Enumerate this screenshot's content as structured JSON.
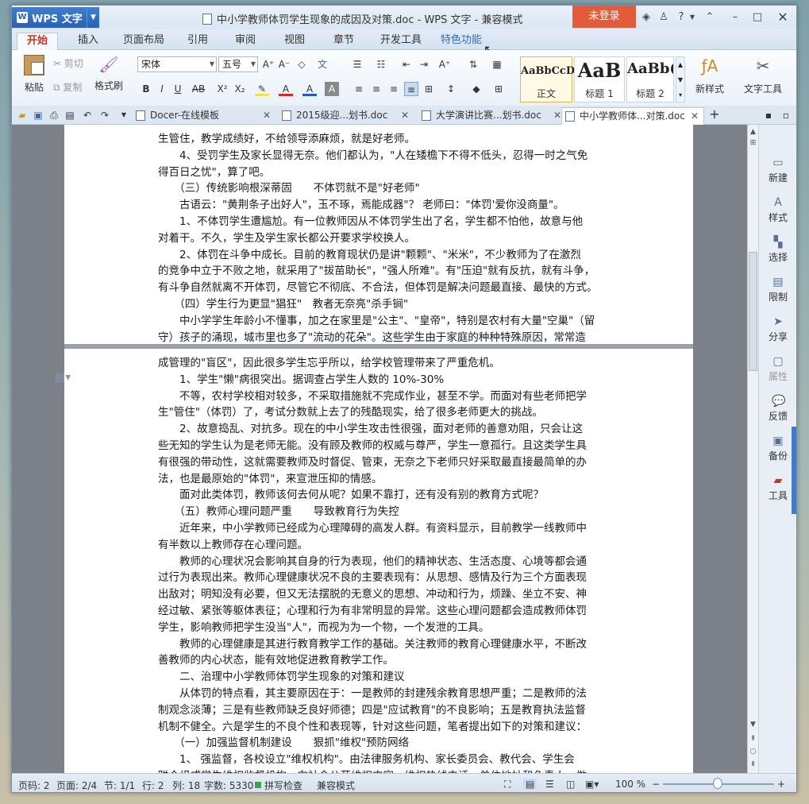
{
  "app": {
    "brand": "WPS 文字",
    "window_title": "中小学教师体罚学生现象的成因及对策.doc - WPS 文字 - 兼容模式",
    "login_label": "未登录",
    "help_label": "?"
  },
  "menu": {
    "tabs": [
      "开始",
      "插入",
      "页面布局",
      "引用",
      "审阅",
      "视图",
      "章节",
      "开发工具",
      "特色功能"
    ],
    "active": "开始"
  },
  "ribbon": {
    "paste": "粘贴",
    "cut": "剪切",
    "copy": "复制",
    "format_painter": "格式刷",
    "font_name": "宋体",
    "font_size": "五号",
    "styles": [
      {
        "sample": "AaBbCcD",
        "name": "正文"
      },
      {
        "sample": "AaB",
        "name": "标题 1"
      },
      {
        "sample": "AaBb(",
        "name": "标题 2"
      }
    ],
    "new_style": "新样式",
    "text_tools": "文字工具"
  },
  "doc_tabs": [
    {
      "label": "Docer-在线模板",
      "active": false
    },
    {
      "label": "2015级迎...划书.doc",
      "active": false
    },
    {
      "label": "大学演讲比赛...划书.doc",
      "active": false
    },
    {
      "label": "中小学教师体...对策.doc",
      "active": true
    }
  ],
  "document": {
    "page1_lines": [
      "生管住，教学成绩好，不给领导添麻烦，就是好老师。",
      "　　4、受罚学生及家长显得无奈。他们都认为，\"人在矮檐下不得不低头，忍得一时之气免",
      "得百日之忧\"，算了吧。",
      "　　（三）传统影响根深蒂固　　不体罚就不是\"好老师\"",
      "　　古语云：\"黄荆条子出好人\"，玉不琢，焉能成器\"？ 老师曰：\"体罚'爱你没商量\"。",
      "　　1、不体罚学生遭尴尬。有一位教师因从不体罚学生出了名，学生都不怕他，故意与他",
      "对着干。不久，学生及学生家长都公开要求学校换人。",
      "　　2、体罚在斗争中成长。目前的教育现状仍是讲\"颗颗\"、\"米米\"，不少教师为了在激烈",
      "的竞争中立于不败之地，就采用了\"拔苗助长\"，\"强人所难\"。有\"压迫\"就有反抗，就有斗争，",
      "有斗争自然就离不开体罚，尽管它不彻底、不合法，但体罚是解决问题最直接、最快的方式。",
      "　　（四）学生行为更显\"猖狂\"　教者无奈亮\"杀手锏\"",
      "　　中小学学生年龄小不懂事，加之在家里是\"公主\"、\"皇帝\"，特别是农村有大量\"空巢\"（留",
      "守）孩子的涌现，城市里也多了\"流动的花朵\"。这些学生由于家庭的种种特殊原因，常常造"
    ],
    "page2_lines": [
      "成管理的\"盲区\"，因此很多学生忘乎所以，给学校管理带来了严重危机。",
      "　　1、学生\"懒\"病很突出。据调查占学生人数的 10%-30%",
      "　　不等，农村学校相对较多，不采取措施就不完成作业，甚至不学。而面对有些老师把学",
      "生\"管住\"（体罚）了，考试分数就上去了的残酷现实，给了很多老师更大的挑战。",
      "　　2、故意捣乱、对抗多。现在的中小学生攻击性很强，面对老师的善意劝阻，只会让这",
      "些无知的学生认为是老师无能。没有顾及教师的权威与尊严，学生一意孤行。且这类学生具",
      "有很强的带动性，这就需要教师及时督促、管束，无奈之下老师只好采取最直接最简单的办",
      "法，也是最原始的\"体罚\"，来宣泄压抑的情感。",
      "　　面对此类体罚，教师该何去何从呢？如果不靠打，还有没有别的教育方式呢？",
      "　　（五）教师心理问题严重　　导致教育行为失控",
      "　　近年来，中小学教师已经成为心理障碍的高发人群。有资料显示，目前教学一线教师中",
      "有半数以上教师存在心理问题。",
      "　　教师的心理状况会影响其自身的行为表现，他们的精神状态、生活态度、心境等都会通",
      "过行为表现出来。教师心理健康状况不良的主要表现有：从思想、感情及行为三个方面表现",
      "出敌对；明知没有必要，但又无法摆脱的无意义的思想、冲动和行为，烦躁、坐立不安、神",
      "经过敏、紧张等躯体表征；心理和行为有非常明显的异常。这些心理问题都会造成教师体罚",
      "学生，影响教师把学生没当\"人\"，而视为为一个物，一个发泄的工具。",
      "　　教师的心理健康是其进行教育教学工作的基础。关注教师的教育心理健康水平，不断改",
      "善教师的内心状态，能有效地促进教育教学工作。",
      "　　二、治理中小学教师体罚学生现象的对策和建议",
      "　　从体罚的特点看，其主要原因在于：一是教师的封建残余教育思想严重；二是教师的法",
      "制观念淡薄；三是有些教师缺乏良好师德；四是\"应试教育\"的不良影响；五是教育执法监督",
      "机制不健全。六是学生的不良个性和表现等，针对这些问题，笔者提出如下的对策和建议：",
      "　　（一）加强监督机制建设　　狠抓\"维权\"预防网络",
      "　　1、 强监督，各校设立\"维权机构\"。由法律服务机构、家长委员会、教代会、学生会",
      "联合组成学生维权监督机构，向社会公开维权内容，维权热线电话，单位地址和负责人，做"
    ]
  },
  "side_panel": [
    "新建",
    "样式",
    "选择",
    "限制",
    "分享",
    "属性",
    "反馈",
    "备份",
    "工具"
  ],
  "status": {
    "page_code": "页码: 2",
    "page": "页面: 2/4",
    "section": "节: 1/1",
    "row": "行: 2",
    "col": "列: 18",
    "word_count": "字数: 5330",
    "spell_check": "拼写检查",
    "compat": "兼容模式",
    "zoom": "100 %"
  }
}
